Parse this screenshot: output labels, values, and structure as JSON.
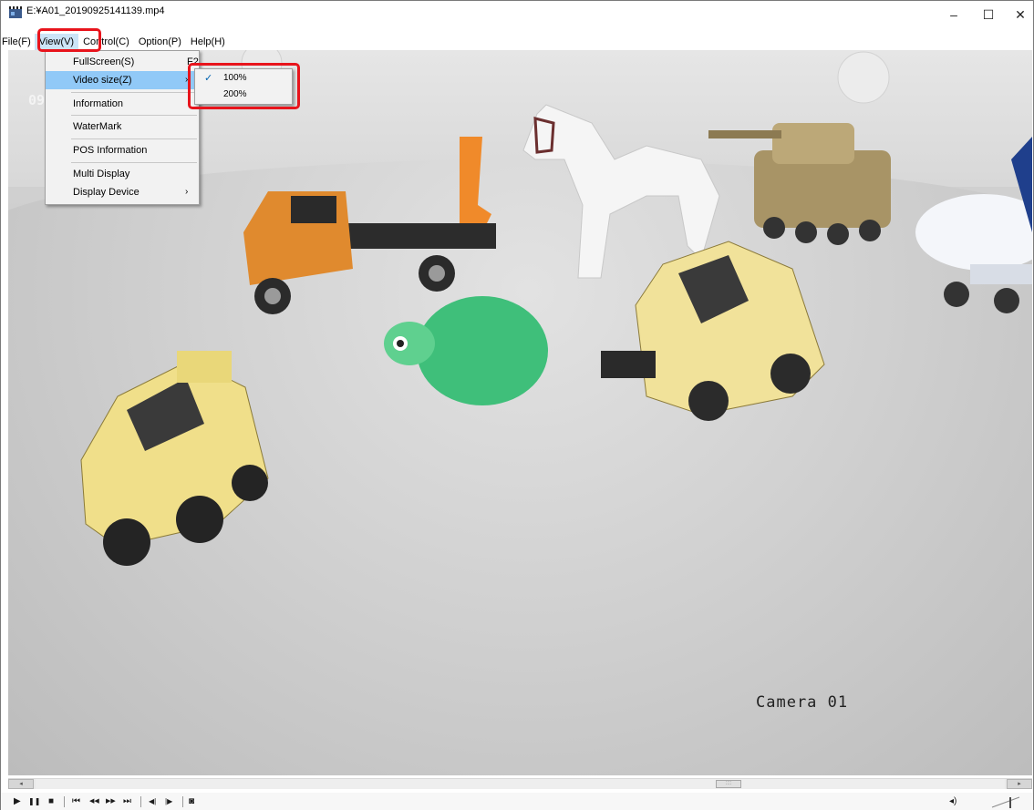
{
  "window": {
    "title": "E:¥A01_20190925141139.mp4",
    "minimize_glyph": "–",
    "maximize_glyph": "☐",
    "close_glyph": "✕"
  },
  "menu": {
    "items": [
      {
        "label": "File(F)"
      },
      {
        "label": "View(V)"
      },
      {
        "label": "Control(C)"
      },
      {
        "label": "Option(P)"
      },
      {
        "label": "Help(H)"
      }
    ]
  },
  "view_menu": {
    "fullscreen": {
      "label": "FullScreen(S)",
      "shortcut": "F2"
    },
    "video_size": {
      "label": "Video size(Z)",
      "arrow": "›"
    },
    "information": {
      "label": "Information"
    },
    "watermark": {
      "label": "WaterMark"
    },
    "pos_information": {
      "label": "POS Information"
    },
    "multi_display": {
      "label": "Multi Display"
    },
    "display_device": {
      "label": "Display Device",
      "arrow": "›"
    }
  },
  "video_size_submenu": {
    "options": [
      {
        "label": "100%",
        "checked": true
      },
      {
        "label": "200%",
        "checked": false
      }
    ],
    "check_glyph": "✓"
  },
  "video": {
    "osd_text": "09",
    "camera_label": "Camera 01"
  },
  "controls": {
    "play": "▶",
    "pause": "❚❚",
    "stop": "■",
    "first": "⏮",
    "rewind": "◀◀",
    "forward": "▶▶",
    "last": "⏭",
    "step_back": "◀|",
    "step_forward": "|▶",
    "snapshot": "◙",
    "volume": "◂)"
  },
  "colors": {
    "highlight_box": "#e8141c",
    "menu_selected": "#91c9f7",
    "check": "#0063b1"
  }
}
